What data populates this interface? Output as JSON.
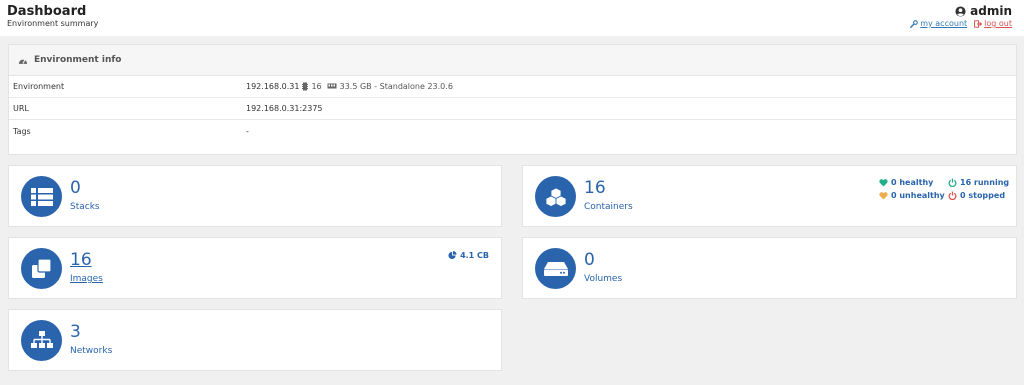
{
  "header": {
    "title": "Dashboard",
    "subtitle": "Environment summary",
    "user": "admin",
    "my_account": "my account",
    "log_out": "log out"
  },
  "environment_info": {
    "title": "Environment info",
    "rows": [
      {
        "key": "Environment",
        "ip": "192.168.0.31",
        "cpu": "16",
        "memory_desc": "33.5 GB - Standalone 23.0.6"
      },
      {
        "key": "URL",
        "value": "192.168.0.31:2375"
      },
      {
        "key": "Tags",
        "value": "-"
      }
    ]
  },
  "cards": {
    "stacks": {
      "value": "0",
      "label": "Stacks"
    },
    "containers": {
      "value": "16",
      "label": "Containers",
      "healthy": "0 healthy",
      "unhealthy": "0 unhealthy",
      "running": "16 running",
      "stopped": "0 stopped"
    },
    "images": {
      "value": "16",
      "label": "Images",
      "size": "4.1 CB"
    },
    "volumes": {
      "value": "0",
      "label": "Volumes"
    },
    "networks": {
      "value": "3",
      "label": "Networks"
    }
  },
  "colors": {
    "accent": "#2a64ad",
    "healthy": "#23ae89",
    "unhealthy": "#f0ad4e",
    "stopped": "#d9534f"
  }
}
